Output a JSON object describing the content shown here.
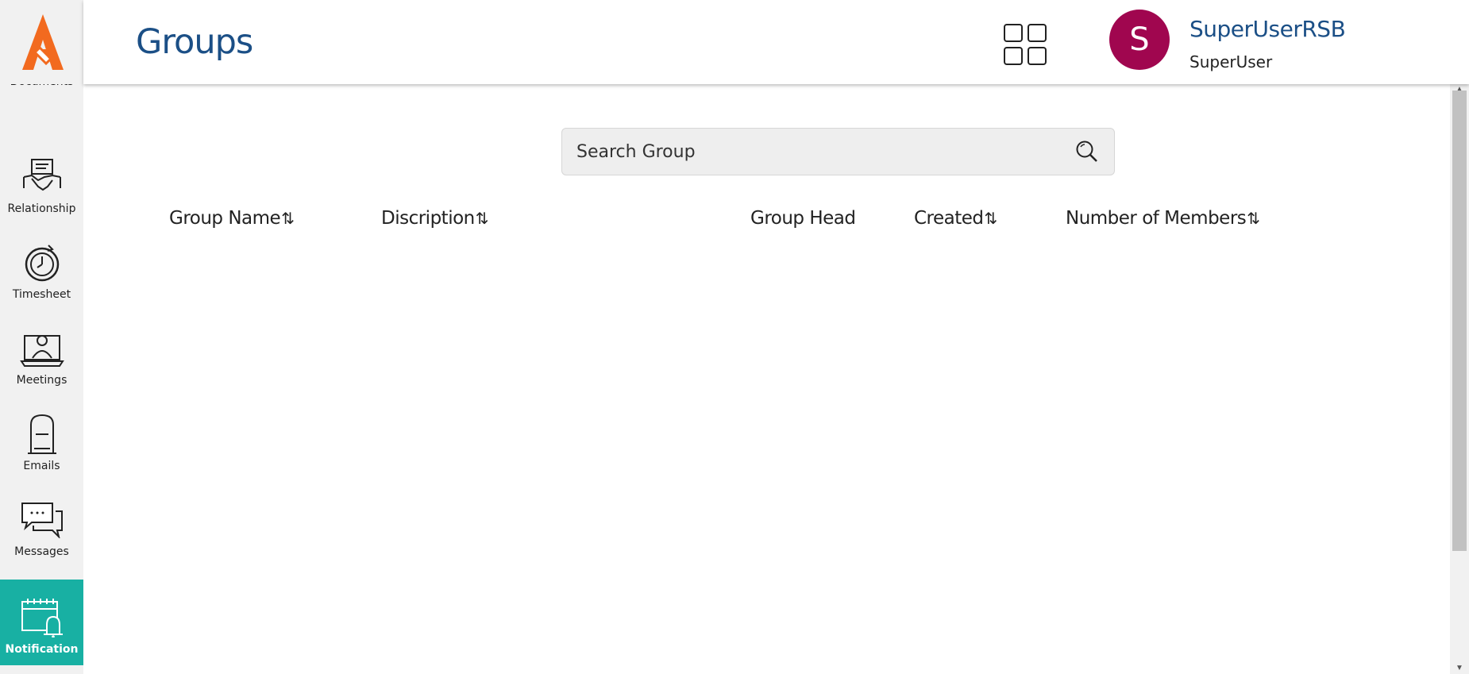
{
  "header": {
    "title": "Groups",
    "user": {
      "avatar_letter": "S",
      "name": "SuperUserRSB",
      "role": "SuperUser"
    },
    "apps_icon": "grid-icon"
  },
  "sidebar": {
    "logo": "brand-logo",
    "items": [
      {
        "label": "Documents",
        "icon": "document-icon",
        "active": false
      },
      {
        "label": "Relationship",
        "icon": "handshake-icon",
        "active": false
      },
      {
        "label": "Timesheet",
        "icon": "stopwatch-icon",
        "active": false
      },
      {
        "label": "Meetings",
        "icon": "video-meeting-icon",
        "active": false
      },
      {
        "label": "Emails",
        "icon": "mailbox-icon",
        "active": false
      },
      {
        "label": "Messages",
        "icon": "chat-icon",
        "active": false
      },
      {
        "label": "Notification",
        "icon": "calendar-bell-icon",
        "active": true
      }
    ]
  },
  "search": {
    "placeholder": "Search Group",
    "value": "",
    "icon": "search-icon"
  },
  "table": {
    "columns": [
      {
        "label": "Group Name",
        "sortable": true
      },
      {
        "label": "Discription",
        "sortable": true
      },
      {
        "label": "Group Head",
        "sortable": false
      },
      {
        "label": "Created",
        "sortable": true
      },
      {
        "label": "Number of Members",
        "sortable": true
      }
    ],
    "sort_glyph": "⇅",
    "rows": []
  },
  "colors": {
    "brand_blue": "#1b4f86",
    "active_teal": "#18b0a3",
    "avatar": "#a0064f",
    "logo_orange": "#f26a1f"
  }
}
